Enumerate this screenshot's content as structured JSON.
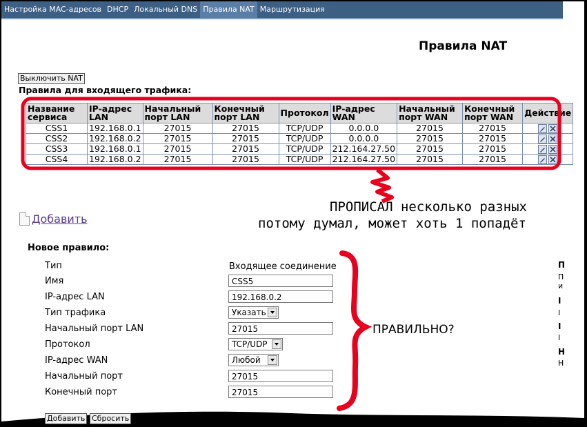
{
  "nav": {
    "tabs": [
      {
        "label": "Настройка MAC-адресов"
      },
      {
        "label": "DHCP"
      },
      {
        "label": "Локальный DNS"
      },
      {
        "label": "Правила NAT",
        "active": true
      },
      {
        "label": "Маршрутизация"
      }
    ]
  },
  "page_title": "Правила NAT",
  "disable_button": "Выключить NAT",
  "section_title": "Правила для входящего трафика:",
  "table": {
    "headers": [
      "Название сервиса",
      "IP-адрес LAN",
      "Начальный порт LAN",
      "Конечный порт LAN",
      "Протокол",
      "IP-адрес WAN",
      "Начальный порт WAN",
      "Конечный порт WAN",
      "Действие"
    ],
    "rows": [
      [
        "CSS1",
        "192.168.0.1",
        "27015",
        "27015",
        "TCP/UDP",
        "0.0.0.0",
        "27015",
        "27015"
      ],
      [
        "CSS2",
        "192.168.0.2",
        "27015",
        "27015",
        "TCP/UDP",
        "0.0.0.0",
        "27015",
        "27015"
      ],
      [
        "CSS3",
        "192.168.0.1",
        "27015",
        "27015",
        "TCP/UDP",
        "212.164.27.50",
        "27015",
        "27015"
      ],
      [
        "CSS4",
        "192.168.0.2",
        "27015",
        "27015",
        "TCP/UDP",
        "212.164.27.50",
        "27015",
        "27015"
      ]
    ],
    "action_icons": [
      "edit-icon",
      "delete-icon"
    ]
  },
  "annotations": {
    "note_line1": "ПРОПИСАЛ несколько разных",
    "note_line2": "потому думал, может хоть 1 попадёт",
    "question": "ПРАВИЛЬНО?",
    "color": "#e8001c"
  },
  "add_link": "Добавить",
  "new_rule": {
    "title": "Новое правило:",
    "fields": [
      {
        "label": "Тип",
        "value": "Входящее соединение",
        "kind": "static"
      },
      {
        "label": "Имя",
        "value": "CSS5",
        "kind": "input"
      },
      {
        "label": "IP-адрес LAN",
        "value": "192.168.0.2",
        "kind": "input"
      },
      {
        "label": "Тип трафика",
        "value": "Указать",
        "kind": "select"
      },
      {
        "label": "Начальный порт LAN",
        "value": "27015",
        "kind": "input"
      },
      {
        "label": "Протокол",
        "value": "TCP/UDP",
        "kind": "select"
      },
      {
        "label": "IP-адрес WAN",
        "value": "Любой",
        "kind": "select"
      },
      {
        "label": "Начальный порт",
        "value": "27015",
        "kind": "input"
      },
      {
        "label": "Конечный порт",
        "value": "27015",
        "kind": "input"
      }
    ],
    "add_button": "Добавить",
    "reset_button": "Сбросить"
  },
  "right_fragments": [
    "П",
    "П",
    "и",
    "I",
    "I",
    "I",
    "I",
    "Н",
    "Н"
  ],
  "colors": {
    "nav_bg": "#3d5f84",
    "nav_active": "#5a7ea6",
    "table_header_bg": "#dcdcdc",
    "link": "#5a3a8a"
  }
}
